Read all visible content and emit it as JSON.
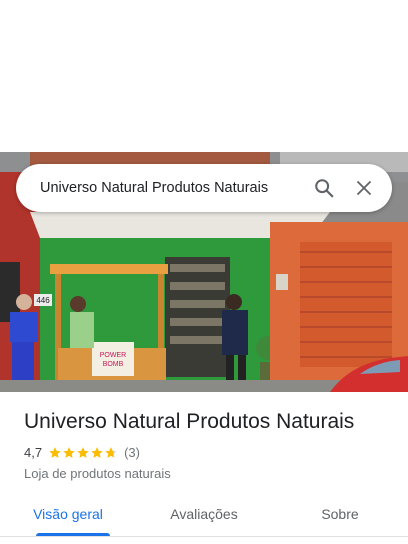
{
  "search": {
    "query": "Universo Natural Produtos Naturais"
  },
  "place": {
    "name": "Universo Natural Produtos Naturais",
    "rating": "4,7",
    "stars": 4.7,
    "reviews": "(3)",
    "category": "Loja de produtos naturais"
  },
  "photo": {
    "kiosk_sign_line1": "POWER",
    "kiosk_sign_line2": "BOMB",
    "house_number": "446"
  },
  "tabs": [
    "Visão geral",
    "Avaliações",
    "Sobre"
  ],
  "colors": {
    "accent": "#1a73e8",
    "star": "#fbbc04",
    "text": "#202124",
    "secondary": "#70757a"
  }
}
